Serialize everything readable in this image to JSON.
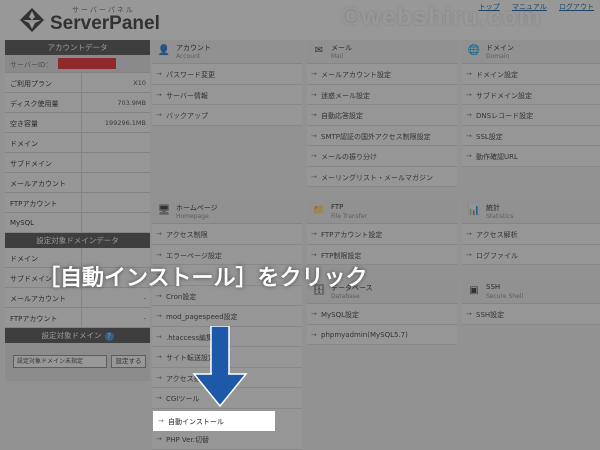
{
  "header": {
    "logo_sub": "サーバーパネル",
    "logo_name": "ServerPanel",
    "links": [
      "トップ",
      "マニュアル",
      "ログアウト"
    ],
    "watermark": "©webshiru.com"
  },
  "sidebar": {
    "account_head": "アカウントデータ",
    "server_id_label": "サーバーID：",
    "rows": [
      {
        "label": "ご利用プラン",
        "value": "X10"
      },
      {
        "label": "ディスク使用量",
        "value": "703.9MB"
      },
      {
        "label": "空き容量",
        "value": "199296.1MB"
      },
      {
        "label": "ドメイン",
        "value": ""
      },
      {
        "label": "サブドメイン",
        "value": ""
      },
      {
        "label": "メールアカウント",
        "value": ""
      },
      {
        "label": "FTPアカウント",
        "value": ""
      },
      {
        "label": "MySQL",
        "value": ""
      }
    ],
    "domain_data_head": "設定対象ドメインデータ",
    "domain_rows": [
      {
        "label": "ドメイン",
        "value": ""
      },
      {
        "label": "サブドメイン",
        "value": ""
      },
      {
        "label": "メールアカウント",
        "value": "-"
      },
      {
        "label": "FTPアカウント",
        "value": "-"
      }
    ],
    "target_head": "設定対象ドメイン",
    "help": "?",
    "select_value": "設定対象ドメイン未指定",
    "set_button": "設定する"
  },
  "categories": {
    "account": {
      "ja": "アカウント",
      "en": "Account",
      "items": [
        "パスワード変更",
        "サーバー情報",
        "バックアップ"
      ]
    },
    "mail": {
      "ja": "メール",
      "en": "Mail",
      "items": [
        "メールアカウント設定",
        "迷惑メール設定",
        "自動応答設定",
        "SMTP認証の国外アクセス制限設定",
        "メールの振り分け",
        "メーリングリスト・メールマガジン"
      ]
    },
    "domain": {
      "ja": "ドメイン",
      "en": "Domain",
      "items": [
        "ドメイン設定",
        "サブドメイン設定",
        "DNSレコード設定",
        "SSL設定",
        "動作確認URL"
      ]
    },
    "homepage": {
      "ja": "ホームページ",
      "en": "Homepage",
      "items": [
        "アクセス制限",
        "エラーページ設定",
        "",
        "Cron設定",
        "mod_pagespeed設定",
        ".htaccess編集",
        "サイト転送設定",
        "アクセス拒否設定",
        "CGIツール",
        "自動インストール",
        "PHP Ver.切替"
      ]
    },
    "ftp": {
      "ja": "FTP",
      "en": "File Transfer",
      "items": [
        "FTPアカウント設定",
        "FTP制限設定"
      ]
    },
    "stats": {
      "ja": "統計",
      "en": "Statistics",
      "items": [
        "アクセス解析",
        "ログファイル"
      ]
    },
    "database": {
      "ja": "データベース",
      "en": "Database",
      "items": [
        "MySQL設定",
        "phpmyadmin(MySQL5.7)"
      ]
    },
    "ssh": {
      "ja": "SSH",
      "en": "Secure Shell",
      "items": [
        "SSH設定"
      ]
    }
  },
  "callout": {
    "text": "［自動インストール］をクリック"
  },
  "colors": {
    "accent_red": "#ea2227",
    "arrow_blue": "#1d59a8",
    "link_blue": "#0b57a0"
  }
}
